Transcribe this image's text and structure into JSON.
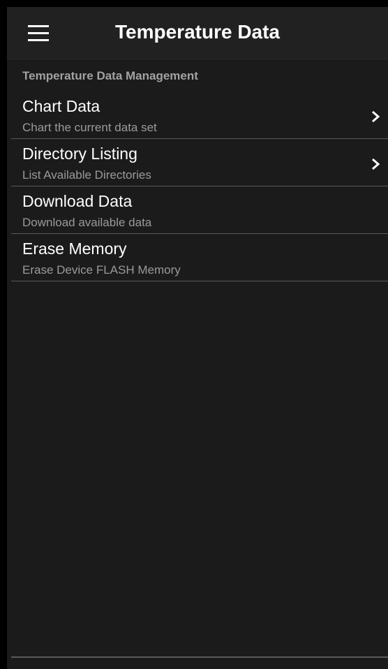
{
  "app_bar": {
    "title": "Temperature Data",
    "menu_icon": "hamburger-menu-icon"
  },
  "section": {
    "header": "Temperature Data Management"
  },
  "items": [
    {
      "title": "Chart Data",
      "subtitle": "Chart the current data set",
      "chevron": true
    },
    {
      "title": "Directory Listing",
      "subtitle": "List Available Directories",
      "chevron": true
    },
    {
      "title": "Download Data",
      "subtitle": "Download available data",
      "chevron": false
    },
    {
      "title": "Erase Memory",
      "subtitle": "Erase Device FLASH Memory",
      "chevron": false
    }
  ],
  "colors": {
    "background": "#1b1b1c",
    "app_bar": "#212121",
    "title_text": "#ffffff",
    "subtitle_text": "#9a9a9a",
    "section_header_text": "#a2a2a2",
    "divider": "#5a5a5a"
  }
}
